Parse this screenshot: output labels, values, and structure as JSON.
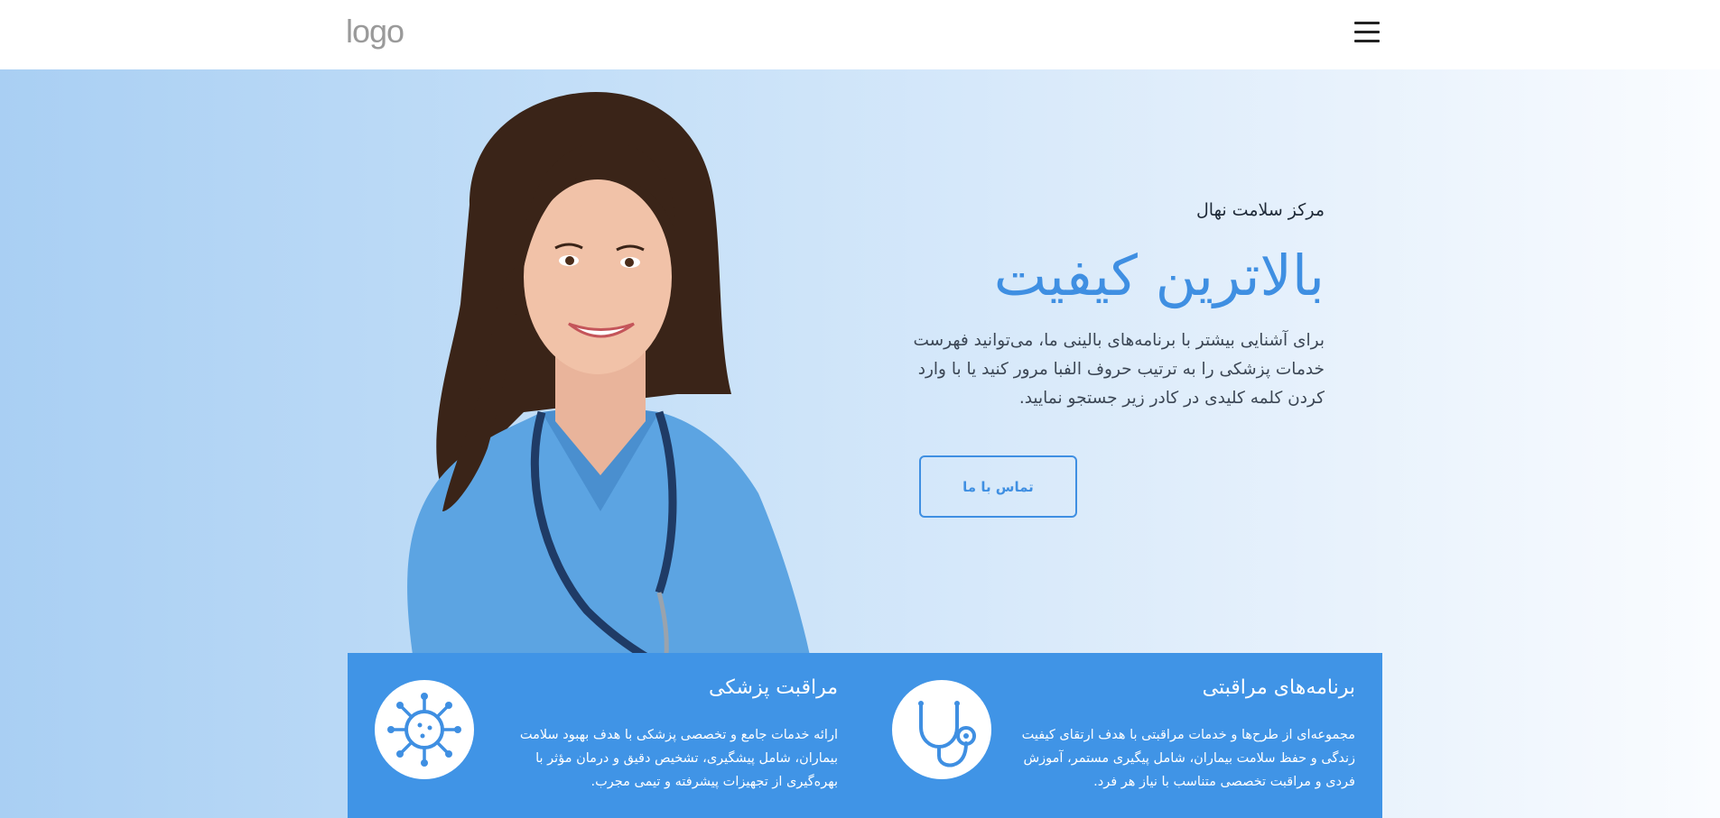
{
  "header": {
    "logo_text": "logo",
    "menu_icon": "hamburger-menu-icon"
  },
  "hero": {
    "kicker": "مرکز سلامت نهال",
    "headline": "بالاترین کیفیت",
    "description": "برای آشنایی بیشتر با برنامه‌های بالینی ما، می‌توانید فهرست خدمات پزشکی را به ترتیب حروف الفبا مرور کنید یا با وارد کردن کلمه کلیدی در کادر زیر جستجو نمایید.",
    "cta_label": "تماس با ما",
    "image": "smiling-nurse-with-stethoscope"
  },
  "features": [
    {
      "title": "برنامه‌های مراقبتی",
      "text": "مجموعه‌ای از طرح‌ها و خدمات مراقبتی با هدف ارتقای کیفیت زندگی و حفظ سلامت بیماران، شامل پیگیری مستمر، آموزش فردی و مراقبت تخصصی متناسب با نیاز هر فرد.",
      "icon": "stethoscope-icon"
    },
    {
      "title": "مراقبت پزشکی",
      "text": "ارائه خدمات جامع و تخصصی پزشکی با هدف بهبود سلامت بیماران، شامل پیشگیری، تشخیص دقیق و درمان مؤثر با بهره‌گیری از تجهیزات پیشرفته و تیمی مجرب.",
      "icon": "virus-icon"
    }
  ],
  "colors": {
    "accent": "#3f8fe2",
    "feature_bg": "#4094e6",
    "hero_gradient_left": "#a9cff3",
    "hero_gradient_right": "#fafcff"
  }
}
